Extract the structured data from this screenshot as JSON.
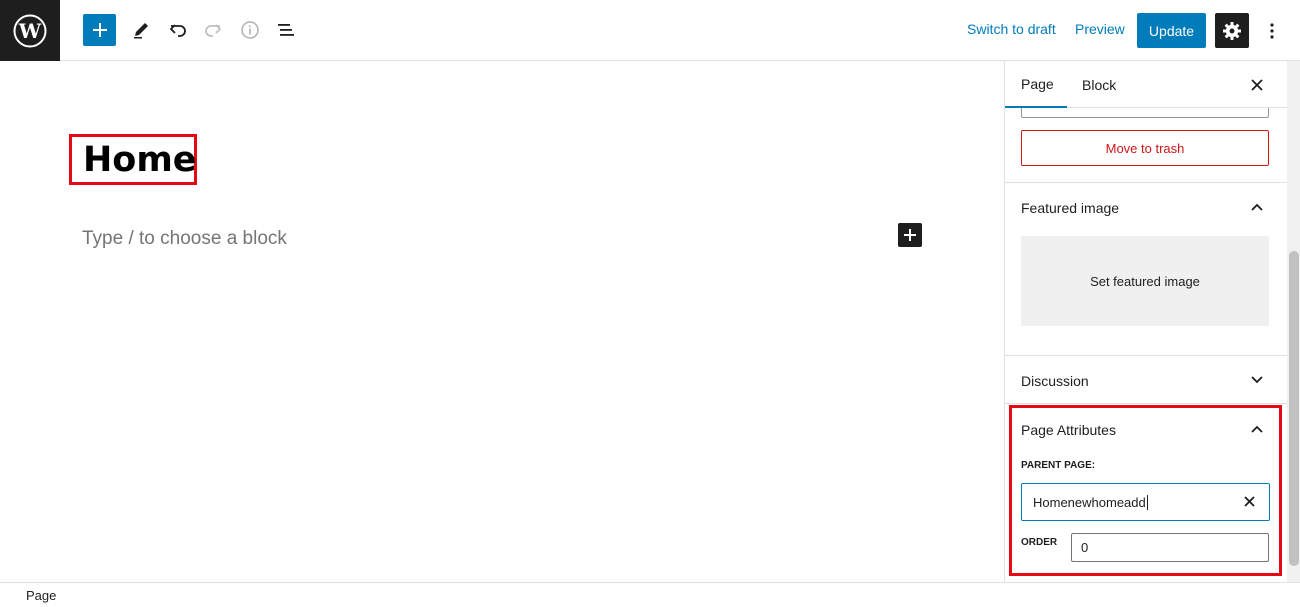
{
  "toolbar": {
    "switch_to_draft": "Switch to draft",
    "preview": "Preview",
    "update": "Update"
  },
  "editor": {
    "title": "Home",
    "block_placeholder": "Type / to choose a block"
  },
  "sidebar": {
    "tabs": [
      "Page",
      "Block"
    ],
    "move_to_trash": "Move to trash",
    "featured_image": {
      "title": "Featured image",
      "set_label": "Set featured image"
    },
    "discussion": {
      "title": "Discussion"
    },
    "page_attributes": {
      "title": "Page Attributes",
      "parent_label": "PARENT PAGE:",
      "parent_value": "Homenewhomeadd",
      "order_label": "ORDER",
      "order_value": "0"
    }
  },
  "footer": {
    "breadcrumb": "Page"
  },
  "colors": {
    "accent": "#007cba",
    "dark": "#1e1e1e",
    "danger": "#cc1818",
    "highlight": "#e50914"
  }
}
